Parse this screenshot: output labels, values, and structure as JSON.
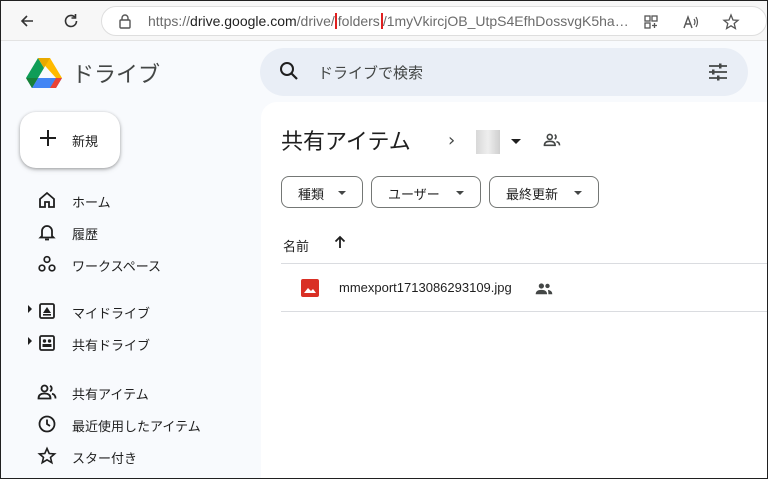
{
  "browser": {
    "url_prefix": "https://",
    "url_host": "drive.google.com",
    "url_path_a": "/drive/",
    "url_highlight": "folders",
    "url_path_b": "/1myVkircjOB_UtpS4EfhDossvgK5hae..."
  },
  "header": {
    "brand": "ドライブ",
    "search_placeholder": "ドライブで検索"
  },
  "sidebar": {
    "new_label": "新規",
    "items": [
      {
        "label": "ホーム",
        "icon": "home-icon"
      },
      {
        "label": "履歴",
        "icon": "bell-icon"
      },
      {
        "label": "ワークスペース",
        "icon": "workspaces-icon"
      },
      {
        "label": "マイドライブ",
        "icon": "my-drive-icon"
      },
      {
        "label": "共有ドライブ",
        "icon": "shared-drive-icon"
      },
      {
        "label": "共有アイテム",
        "icon": "people-icon"
      },
      {
        "label": "最近使用したアイテム",
        "icon": "clock-icon"
      },
      {
        "label": "スター付き",
        "icon": "star-icon"
      }
    ]
  },
  "main": {
    "title": "共有アイテム",
    "breadcrumb_sep": "›",
    "filters": [
      "種類",
      "ユーザー",
      "最終更新"
    ],
    "column_name": "名前",
    "files": [
      {
        "name": "mmexport1713086293109.jpg",
        "shared": true
      }
    ]
  },
  "colors": {
    "highlight": "#e02020",
    "image_file": "#d93025",
    "search_bg": "#e9eef6"
  }
}
